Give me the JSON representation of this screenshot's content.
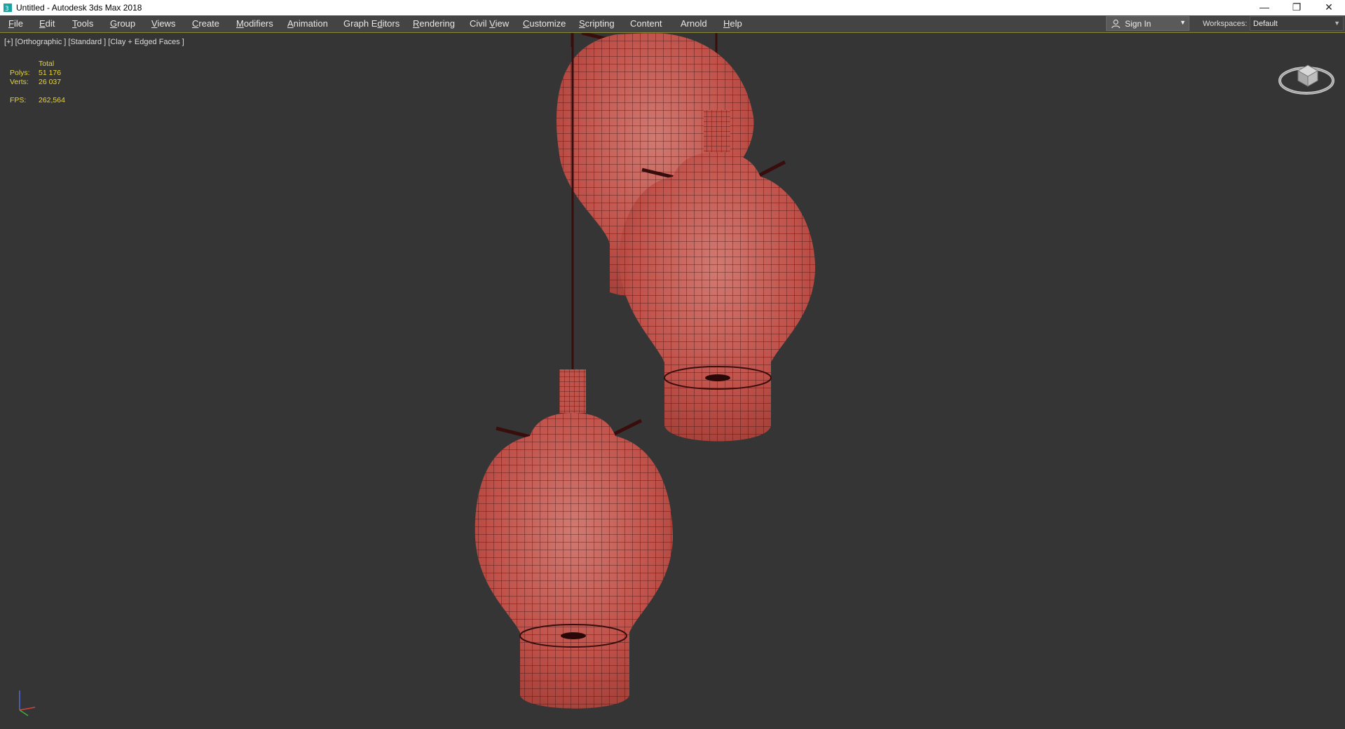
{
  "window": {
    "title": "Untitled - Autodesk 3ds Max 2018",
    "minimize_glyph": "—",
    "restore_glyph": "❐",
    "close_glyph": "✕"
  },
  "menu": {
    "items": [
      {
        "underline": "F",
        "rest": "ile"
      },
      {
        "underline": "E",
        "rest": "dit"
      },
      {
        "underline": "T",
        "rest": "ools"
      },
      {
        "underline": "G",
        "rest": "roup"
      },
      {
        "underline": "V",
        "rest": "iews"
      },
      {
        "underline": "C",
        "rest": "reate"
      },
      {
        "underline": "M",
        "rest": "odifiers"
      },
      {
        "underline": "A",
        "rest": "nimation"
      },
      {
        "pre": "Graph E",
        "underline": "d",
        "rest": "itors"
      },
      {
        "underline": "R",
        "rest": "endering"
      },
      {
        "pre": "Civil ",
        "underline": "V",
        "rest": "iew"
      },
      {
        "underline": "C",
        "rest": "ustomize"
      },
      {
        "underline": "S",
        "rest": "cripting"
      },
      {
        "pre": "",
        "underline": "",
        "rest": "Content"
      },
      {
        "pre": "",
        "underline": "",
        "rest": "Arnold"
      },
      {
        "underline": "H",
        "rest": "elp"
      }
    ],
    "sign_in": "Sign In",
    "workspaces_label": "Workspaces:",
    "workspace_value": "Default"
  },
  "viewport": {
    "label": "[+] [Orthographic ] [Standard ] [Clay + Edged Faces ]",
    "stats": {
      "header": "Total",
      "polys_label": "Polys:",
      "polys_value": "51 176",
      "verts_label": "Verts:",
      "verts_value": "26 037",
      "fps_label": "FPS:",
      "fps_value": "262,564"
    },
    "background_color": "#353535",
    "mesh_color": "#c0524a",
    "wire_color": "#3a0d0d"
  }
}
